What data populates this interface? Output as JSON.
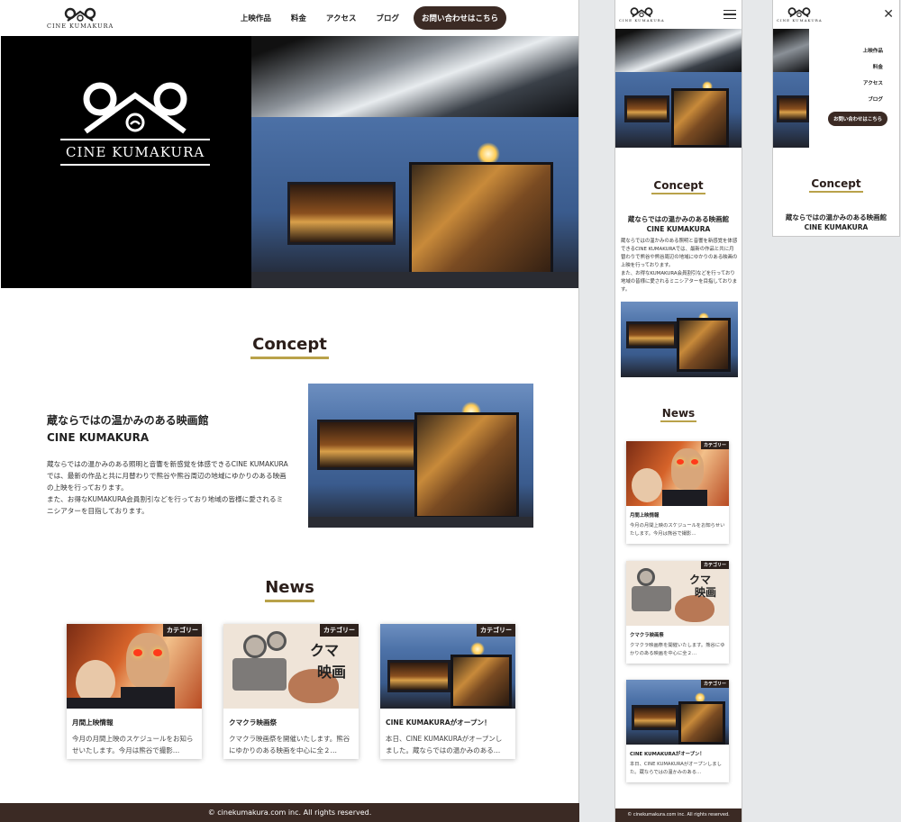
{
  "brand": {
    "name": "CINE KUMAKURA"
  },
  "nav": {
    "items": [
      "上映作品",
      "料金",
      "アクセス",
      "ブログ"
    ],
    "cta": "お問い合わせはこちら"
  },
  "concept": {
    "heading": "Concept",
    "title_line1": "蔵ならではの温かみのある映画館",
    "title_line2": "CINE KUMAKURA",
    "body": "蔵ならではの温かみのある照明と音響を新感覚を体感できるCINE KUMAKURAでは、最新の作品と共に月替わりで熊谷や熊谷周辺の地域にゆかりのある映画の上映を行っております。",
    "body2": "また、お得なKUMAKURA会員割引などを行っており地域の皆様に愛されるミニシアターを目指しております。"
  },
  "news": {
    "heading": "News",
    "category_label": "カテゴリー",
    "items": [
      {
        "title": "月間上映情報",
        "text": "今月の月間上映のスケジュールをお知らせいたします。今月は熊谷で撮影…"
      },
      {
        "title": "クマクラ映画祭",
        "text": "クマクラ映画祭を開催いたします。熊谷にゆかりのある映画を中心に全２…"
      },
      {
        "title": "CINE KUMAKURAがオープン！",
        "text": "本日、CINE KUMAKURAがオープンしました。蔵ならではの温かみのある…"
      }
    ]
  },
  "footer": {
    "copyright": "© cinekumakura.com inc. All rights reserved."
  },
  "colors": {
    "dark_brown": "#3b2a24",
    "accent_gold": "#b9a24a"
  },
  "icons": {
    "menu": "hamburger-icon",
    "close": "close-icon"
  }
}
